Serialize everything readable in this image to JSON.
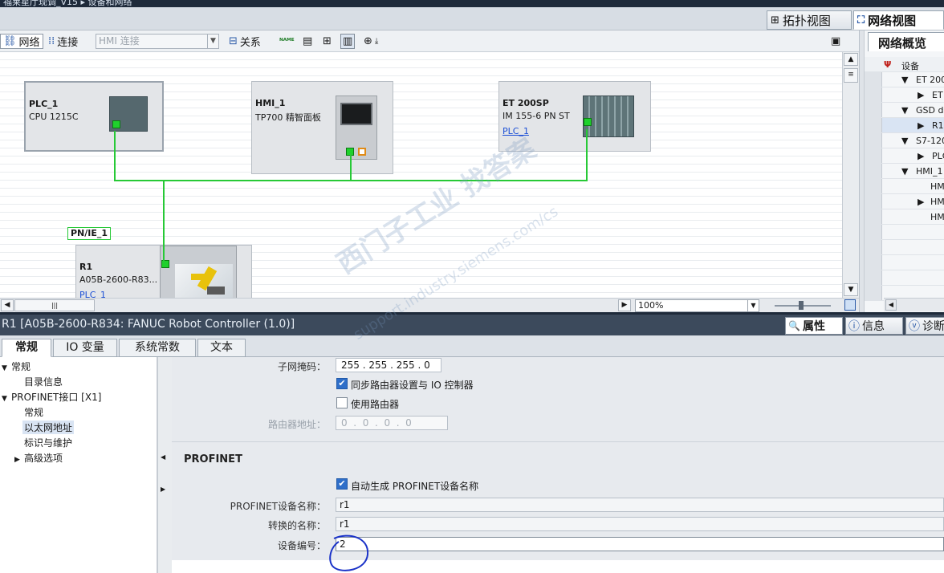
{
  "window": {
    "title": "福莱星厅现调_V15 ▸ 设备和网络"
  },
  "view_tabs": {
    "topology": "拓扑视图",
    "network": "网络视图"
  },
  "toolbar": {
    "network": "网络",
    "connections": "连接",
    "connection_type": "HMI 连接",
    "relations": "关系"
  },
  "devices": {
    "plc": {
      "name": "PLC_1",
      "type": "CPU 1215C"
    },
    "hmi": {
      "name": "HMI_1",
      "type": "TP700 精智面板"
    },
    "et200": {
      "name": "ET 200SP",
      "type": "IM 155-6 PN ST",
      "link": "PLC_1"
    },
    "robot": {
      "name": "R1",
      "type": "A05B-2600-R83...",
      "link": "PLC_1"
    }
  },
  "subnet_label": "PN/IE_1",
  "zoom": {
    "value": "100%"
  },
  "overview": {
    "tab": "网络概览",
    "header": "设备",
    "rows": [
      "ET 200",
      "ET",
      "GSD d",
      "R1",
      "S7-120",
      "PLC",
      "HMI_1",
      "HM",
      "HM",
      "HM"
    ]
  },
  "properties": {
    "title": "R1 [A05B-2600-R834: FANUC Robot Controller (1.0)]",
    "tabs": {
      "props": "属性",
      "info": "信息",
      "diag": "诊断"
    },
    "subtabs": [
      "常规",
      "IO 变量",
      "系统常数",
      "文本"
    ],
    "nav": {
      "general": "常规",
      "catalog": "目录信息",
      "profinet": "PROFINET接口 [X1]",
      "general2": "常规",
      "ethernet": "以太网地址",
      "identification": "标识与维护",
      "advanced": "高级选项"
    },
    "form": {
      "subnet_mask_label": "子网掩码：",
      "subnet_mask": [
        "255",
        "255",
        "255",
        "0"
      ],
      "sync_router_label": "同步路由器设置与 IO 控制器",
      "use_router_label": "使用路由器",
      "router_addr_label": "路由器地址：",
      "router_addr": [
        "0",
        "0",
        "0",
        "0"
      ],
      "profinet_section": "PROFINET",
      "auto_name_label": "自动生成 PROFINET设备名称",
      "device_name_label": "PROFINET设备名称：",
      "device_name": "r1",
      "converted_name_label": "转换的名称：",
      "converted_name": "r1",
      "device_number_label": "设备编号：",
      "device_number": "2"
    }
  },
  "watermark": {
    "text1": "西门子工业   找答案",
    "text2": "support.industry.siemens.com/cs"
  }
}
